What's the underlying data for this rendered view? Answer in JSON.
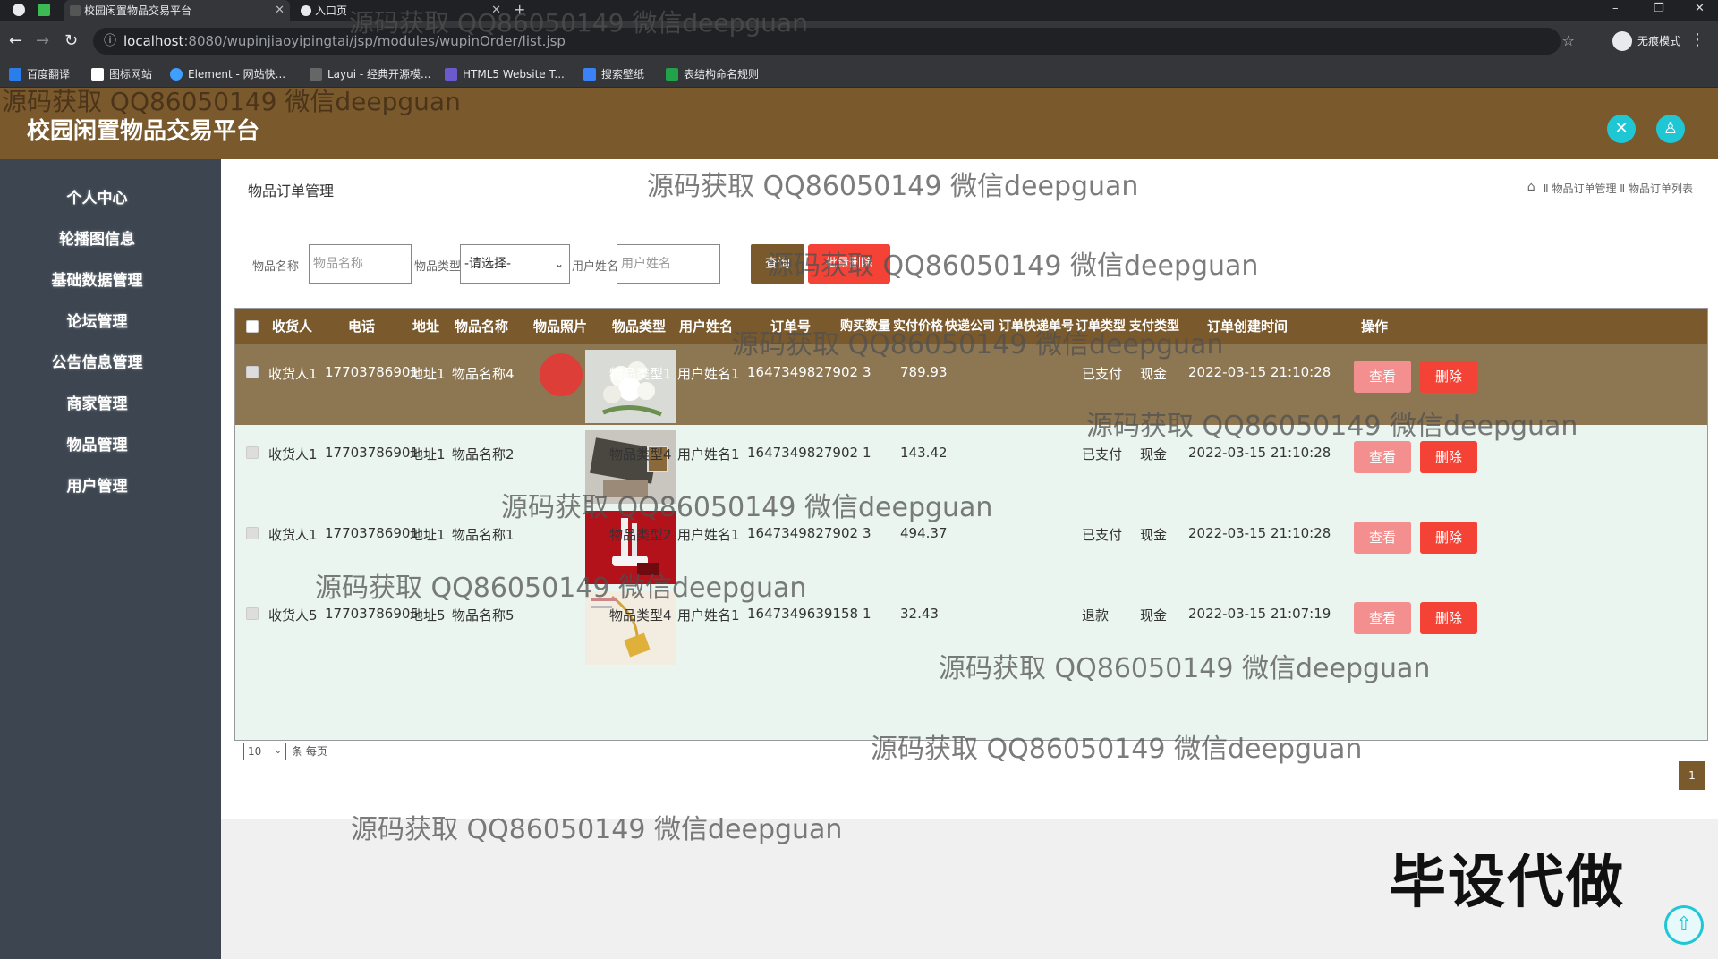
{
  "browser": {
    "tabs": [
      {
        "label": "校园闲置物品交易平台",
        "close": "✕"
      },
      {
        "label": "入口页",
        "close": "✕"
      }
    ],
    "new_tab": "+",
    "url_host": "localhost",
    "url_path": ":8080/wupinjiaoyipingtai/jsp/modules/wupinOrder/list.jsp",
    "profile_label": "无痕模式",
    "window_controls": {
      "minimize": "–",
      "restore": "❐",
      "close": "✕"
    },
    "bookmarks": [
      "百度翻译",
      "图标网站",
      "Element - 网站快...",
      "Layui - 经典开源模...",
      "HTML5 Website T...",
      "搜索壁纸",
      "表结构命名规则"
    ]
  },
  "app": {
    "title": "校园闲置物品交易平台",
    "header_icons": [
      "close-circle-icon",
      "user-icon"
    ]
  },
  "sidebar": {
    "items": [
      "个人中心",
      "轮播图信息",
      "基础数据管理",
      "论坛管理",
      "公告信息管理",
      "商家管理",
      "物品管理",
      "用户管理"
    ]
  },
  "page": {
    "title": "物品订单管理",
    "breadcrumb": "Ⅱ 物品订单管理 Ⅱ 物品订单列表"
  },
  "search": {
    "name_label": "物品名称",
    "name_placeholder": "物品名称",
    "type_label": "物品类型",
    "type_selected": "-请选择-",
    "user_label": "用户姓名",
    "user_placeholder": "用户姓名",
    "query_button": "查询",
    "batch_delete_button": "批量删除"
  },
  "table": {
    "headers": [
      "收货人",
      "电话",
      "地址",
      "物品名称",
      "物品照片",
      "物品类型",
      "用户姓名",
      "订单号",
      "购买数量",
      "实付价格",
      "快递公司",
      "订单快递单号",
      "订单类型",
      "支付类型",
      "订单创建时间",
      "操作"
    ],
    "rows": [
      {
        "receiver": "收货人1",
        "phone": "17703786901",
        "address": "地址1",
        "name": "物品名称4",
        "type": "物品类型1",
        "user": "用户姓名1",
        "order_no": "1647349827902",
        "qty": "3",
        "price": "789.93",
        "status": "已支付",
        "pay": "现金",
        "time": "2022-03-15 21:10:28"
      },
      {
        "receiver": "收货人1",
        "phone": "17703786901",
        "address": "地址1",
        "name": "物品名称2",
        "type": "物品类型4",
        "user": "用户姓名1",
        "order_no": "1647349827902",
        "qty": "1",
        "price": "143.42",
        "status": "已支付",
        "pay": "现金",
        "time": "2022-03-15 21:10:28"
      },
      {
        "receiver": "收货人1",
        "phone": "17703786901",
        "address": "地址1",
        "name": "物品名称1",
        "type": "物品类型2",
        "user": "用户姓名1",
        "order_no": "1647349827902",
        "qty": "3",
        "price": "494.37",
        "status": "已支付",
        "pay": "现金",
        "time": "2022-03-15 21:10:28"
      },
      {
        "receiver": "收货人5",
        "phone": "17703786905",
        "address": "地址5",
        "name": "物品名称5",
        "type": "物品类型4",
        "user": "用户姓名1",
        "order_no": "1647349639158",
        "qty": "1",
        "price": "32.43",
        "status": "退款",
        "pay": "现金",
        "time": "2022-03-15 21:07:19"
      }
    ],
    "view_button": "查看",
    "delete_button": "删除"
  },
  "pagination": {
    "page_size": "10",
    "page_size_suffix": "条 每页",
    "current_page": "1"
  },
  "overlay": {
    "watermark": "源码获取 QQ86050149 微信deepguan",
    "slogan": "毕设代做"
  },
  "colors": {
    "brand": "#7a5a2d",
    "sidebar": "#3d4650",
    "danger": "#f44336",
    "accent": "#1fc7d4"
  }
}
